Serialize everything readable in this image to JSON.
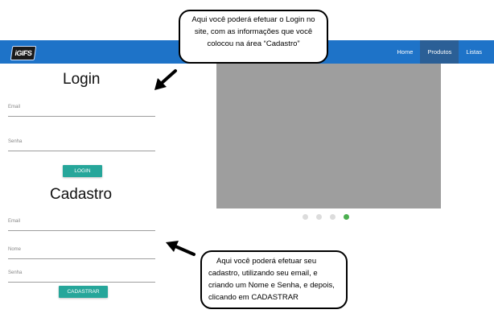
{
  "navbar": {
    "logo_text": "iGIFS",
    "links": [
      "Home",
      "Produtos",
      "Listas"
    ],
    "active_link": "Produtos",
    "color": "#1e73c8"
  },
  "login": {
    "title": "Login",
    "email_label": "Email",
    "senha_label": "Senha",
    "button_label": "LOGIN"
  },
  "cadastro": {
    "title": "Cadastro",
    "email_label": "Email",
    "nome_label": "Nome",
    "senha_label": "Senha",
    "button_label": "CADASTRAR"
  },
  "carousel": {
    "dot_count": 4,
    "active_dot": 4
  },
  "callouts": {
    "top_text": "Aqui você poderá efetuar o Login no site, com as informações que você colocou na área “Cadastro”",
    "bottom_text": "Aqui você poderá efetuar seu cadastro, utilizando seu email, e criando um Nome e Senha, e depois, clicando em CADASTRAR"
  },
  "colors": {
    "button": "#26a69a",
    "active_dot": "#4caf50"
  }
}
